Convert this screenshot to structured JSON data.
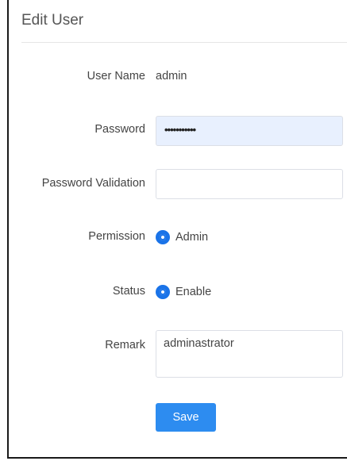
{
  "form": {
    "title": "Edit User",
    "user_name": {
      "label": "User Name",
      "value": "admin"
    },
    "password": {
      "label": "Password",
      "masked_value": "•••••••••••"
    },
    "password_validation": {
      "label": "Password Validation",
      "value": ""
    },
    "permission": {
      "label": "Permission",
      "option": "Admin",
      "selected": true
    },
    "status": {
      "label": "Status",
      "option": "Enable",
      "selected": true
    },
    "remark": {
      "label": "Remark",
      "value": "adminastrator"
    },
    "save_label": "Save"
  },
  "colors": {
    "accent": "#2d8cf0",
    "radio": "#1a73e8",
    "autofill_bg": "#e8f0fe"
  }
}
